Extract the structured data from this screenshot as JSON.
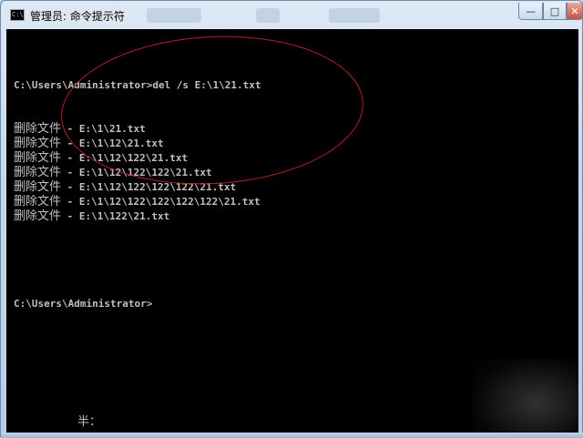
{
  "window": {
    "title": "管理员: 命令提示符",
    "icon": "cmd-window-icon",
    "icon_text": "C:\\"
  },
  "controls": {
    "minimize": "—",
    "maximize": "□",
    "close": "✕"
  },
  "console": {
    "command_line": "C:\\Users\\Administrator>del /s E:\\1\\21.txt",
    "deleted": [
      {
        "label": "删除文件",
        "sep": " - ",
        "path": "E:\\1\\21.txt"
      },
      {
        "label": "删除文件",
        "sep": " - ",
        "path": "E:\\1\\12\\21.txt"
      },
      {
        "label": "删除文件",
        "sep": " - ",
        "path": "E:\\1\\12\\122\\21.txt"
      },
      {
        "label": "删除文件",
        "sep": " - ",
        "path": "E:\\1\\12\\122\\122\\21.txt"
      },
      {
        "label": "删除文件",
        "sep": " - ",
        "path": "E:\\1\\12\\122\\122\\122\\21.txt"
      },
      {
        "label": "删除文件",
        "sep": " - ",
        "path": "E:\\1\\12\\122\\122\\122\\122\\21.txt"
      },
      {
        "label": "删除文件",
        "sep": " - ",
        "path": "E:\\1\\122\\21.txt"
      }
    ],
    "prompt": "C:\\Users\\Administrator>",
    "ime_status": "半："
  },
  "colors": {
    "console_bg": "#000000",
    "console_text": "#c0c0c0",
    "annotation": "#b32424"
  }
}
